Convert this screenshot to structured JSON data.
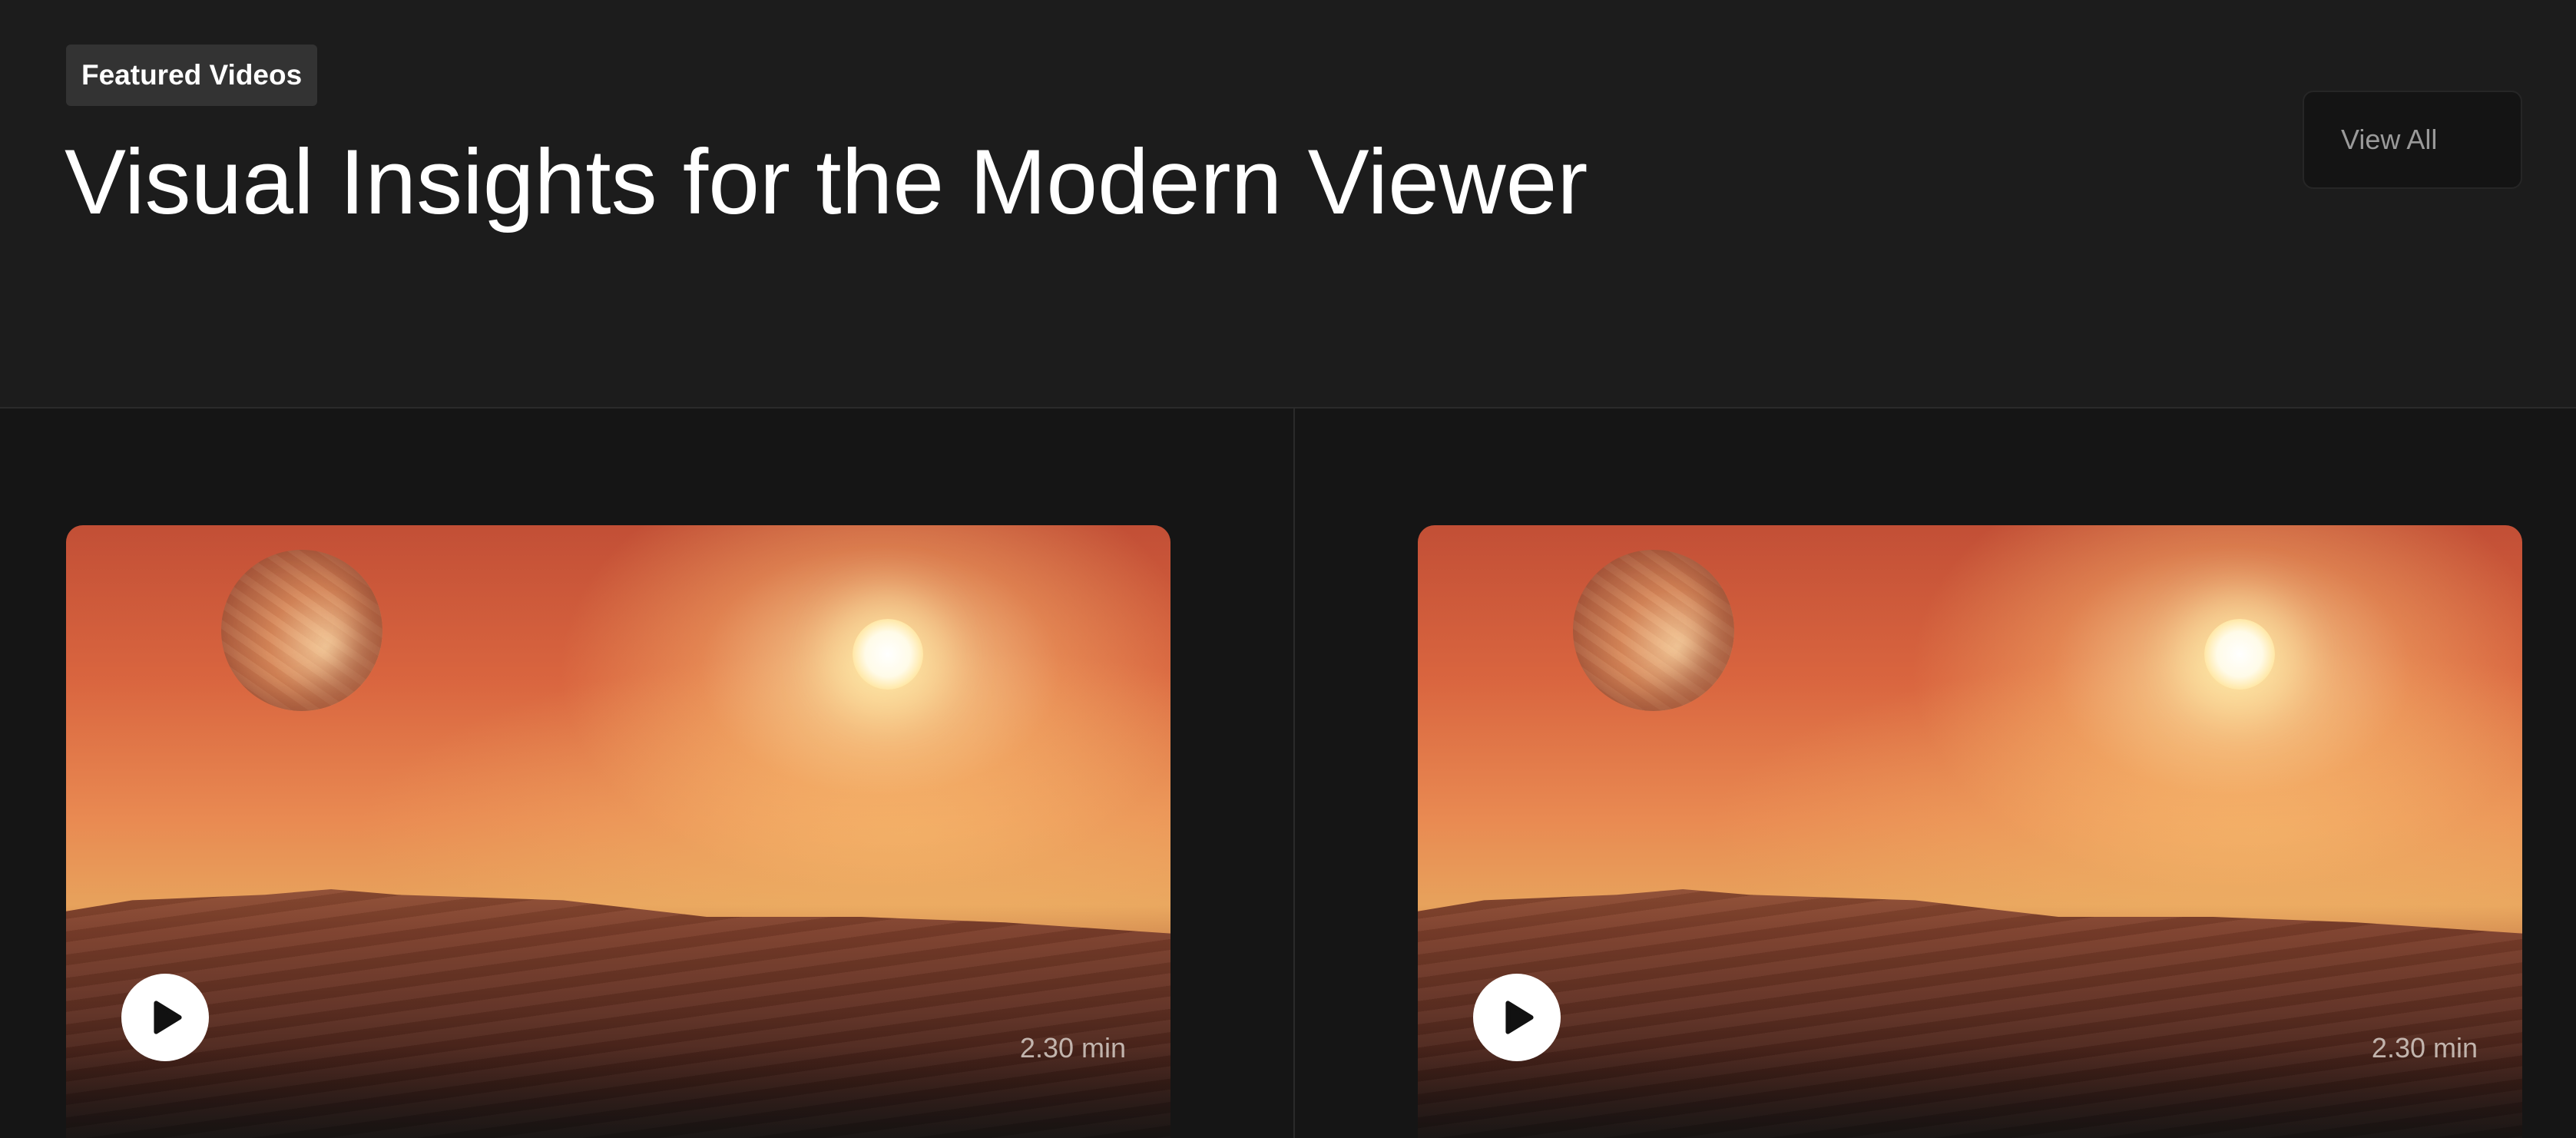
{
  "header": {
    "badge": "Featured Videos",
    "title": "Visual Insights for the Modern Viewer",
    "view_all_label": "View All"
  },
  "videos": [
    {
      "duration": "2.30 min",
      "play_icon": "play-icon"
    },
    {
      "duration": "2.30 min",
      "play_icon": "play-icon"
    }
  ],
  "colors": {
    "background": "#1a1a1a",
    "badge_bg": "#333333",
    "title": "#ffffff",
    "button_bg": "#141414",
    "button_text": "#9a9a9a",
    "play_button": "#ffffff"
  }
}
